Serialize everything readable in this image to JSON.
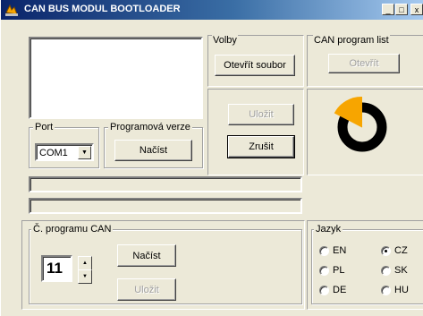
{
  "window": {
    "title": "CAN BUS MODUL BOOTLOADER",
    "caption_minimize": "_",
    "caption_maximize": "□",
    "caption_close": "x"
  },
  "volby": {
    "legend": "Volby",
    "open_file_label": "Otevřít soubor",
    "save_label": "Uložit",
    "cancel_label": "Zrušit"
  },
  "can_program_list": {
    "legend": "CAN program list",
    "open_label": "Otevřít"
  },
  "port": {
    "legend": "Port",
    "selected": "COM1"
  },
  "program_version": {
    "legend": "Programová verze",
    "load_label": "Načíst"
  },
  "can_program_number": {
    "legend": "Č. programu CAN",
    "value": "11",
    "load_label": "Načíst",
    "save_label": "Uložit"
  },
  "language": {
    "legend": "Jazyk",
    "options": [
      {
        "code": "EN",
        "checked": false
      },
      {
        "code": "CZ",
        "checked": true
      },
      {
        "code": "PL",
        "checked": false
      },
      {
        "code": "SK",
        "checked": false
      },
      {
        "code": "DE",
        "checked": false
      },
      {
        "code": "HU",
        "checked": false
      }
    ]
  },
  "colors": {
    "title_bar_start": "#0a246a",
    "title_bar_end": "#a6caf0",
    "logo_orange": "#f7a500",
    "logo_black": "#000000",
    "face": "#ece9d8"
  },
  "icons": {
    "app": "can-bus-app-icon",
    "logo": "bootloader-logo"
  }
}
